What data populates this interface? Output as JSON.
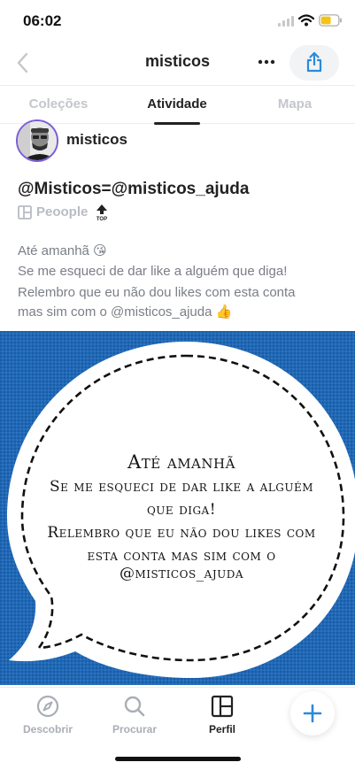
{
  "status_bar": {
    "time": "06:02"
  },
  "nav": {
    "title": "misticos"
  },
  "tabs": [
    {
      "label": "Coleções"
    },
    {
      "label": "Atividade"
    },
    {
      "label": "Mapa"
    }
  ],
  "author": {
    "name": "misticos"
  },
  "post": {
    "title": "@Misticos=@misticos_ajuda",
    "collection": "Peoople",
    "body_lines": [
      "Até amanhã 😘",
      "Se me esqueci de dar like a alguém que diga!",
      "Relembro que eu não dou likes com esta conta",
      "mas sim com o @misticos_ajuda 👍"
    ],
    "image_text": [
      "Até amanhã",
      "Se me esqueci de dar like a alguém",
      "que diga!",
      "Relembro que eu não dou likes com",
      "esta conta mas sim com o @misticos_ajuda"
    ]
  },
  "bottom_nav": [
    {
      "label": "Descobrir",
      "icon": "compass-icon"
    },
    {
      "label": "Procurar",
      "icon": "search-icon"
    },
    {
      "label": "Perfil",
      "icon": "grid-icon"
    }
  ],
  "colors": {
    "image_bg": "#1f67b4",
    "accent": "#2b8ad8",
    "avatar_ring": "#7c5fd6"
  }
}
